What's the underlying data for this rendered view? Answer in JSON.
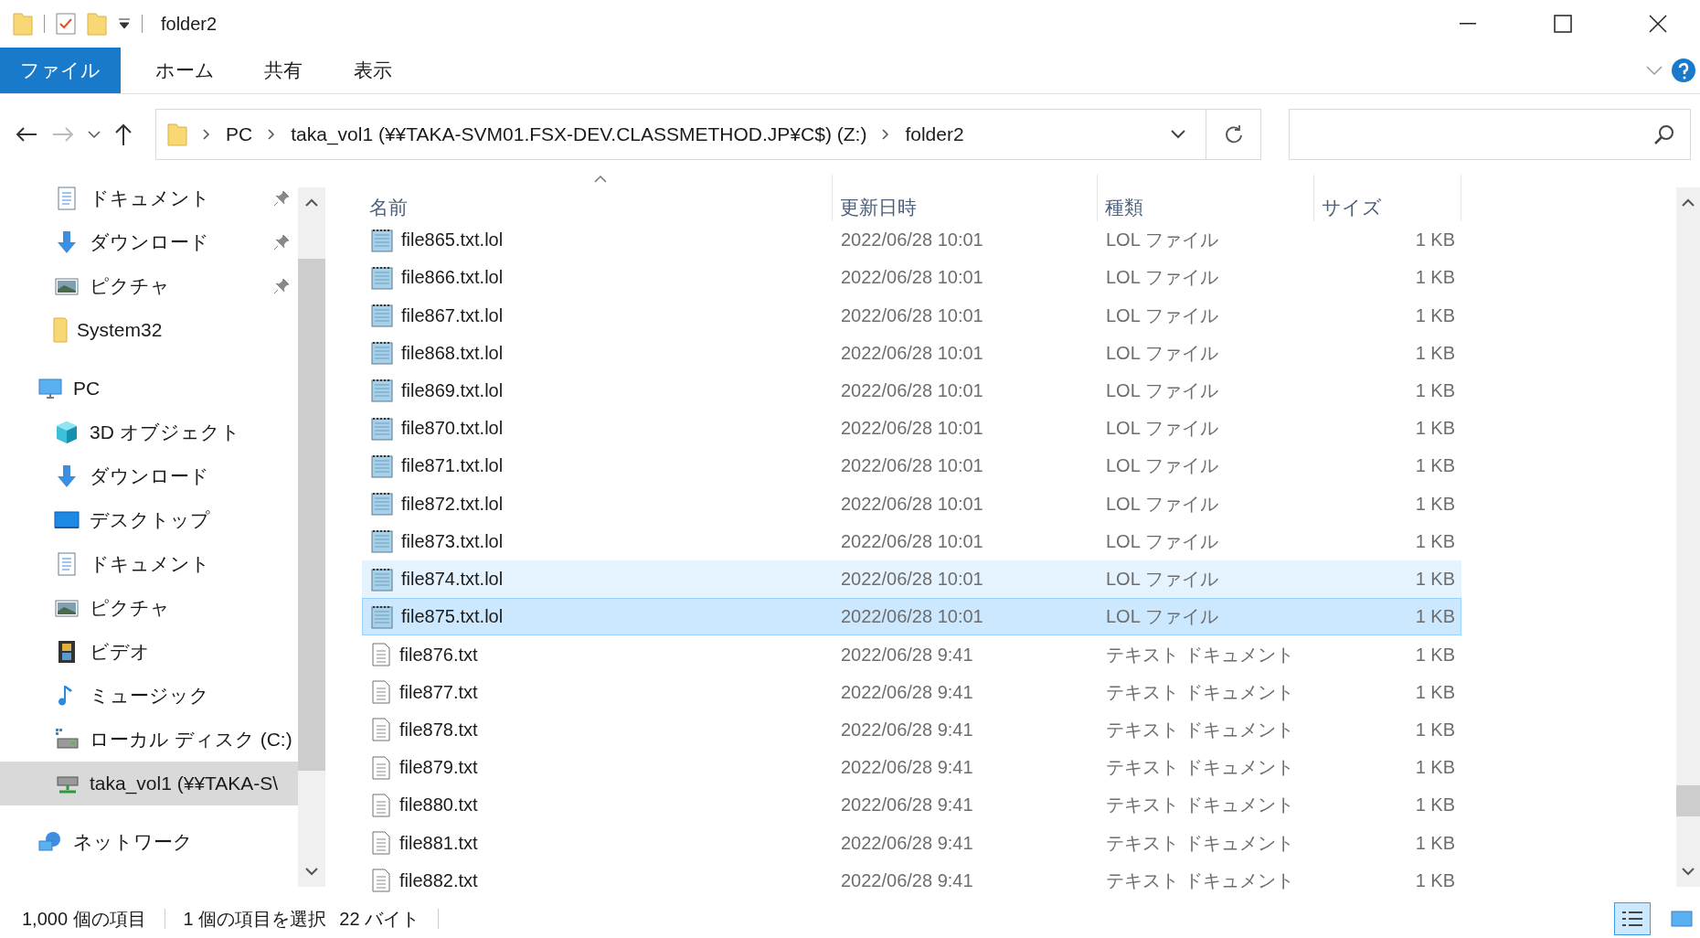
{
  "window": {
    "title": "folder2"
  },
  "ribbon": {
    "tabs": [
      {
        "label": "ファイル",
        "kind": "file"
      },
      {
        "label": "ホーム",
        "kind": "tab"
      },
      {
        "label": "共有",
        "kind": "tab"
      },
      {
        "label": "表示",
        "kind": "tab"
      }
    ]
  },
  "address_bar": {
    "path": [
      "PC",
      "taka_vol1 (¥¥TAKA-SVM01.FSX-DEV.CLASSMETHOD.JP¥C$) (Z:)",
      "folder2"
    ]
  },
  "sidebar": {
    "quick_access_items": [
      {
        "label": "ドキュメント",
        "kind": "document",
        "pinned": true,
        "selected": false
      },
      {
        "label": "ダウンロード",
        "kind": "download",
        "pinned": true,
        "selected": false
      },
      {
        "label": "ピクチャ",
        "kind": "picture",
        "pinned": true,
        "selected": false
      },
      {
        "label": "System32",
        "kind": "folder",
        "pinned": false,
        "selected": false
      }
    ],
    "items": [
      {
        "label": "PC",
        "kind": "pc",
        "selected": false,
        "children": [
          {
            "label": "3D オブジェクト",
            "kind": "cube",
            "selected": false
          },
          {
            "label": "ダウンロード",
            "kind": "download",
            "selected": false
          },
          {
            "label": "デスクトップ",
            "kind": "desktop",
            "selected": false
          },
          {
            "label": "ドキュメント",
            "kind": "document",
            "selected": false
          },
          {
            "label": "ピクチャ",
            "kind": "picture",
            "selected": false
          },
          {
            "label": "ビデオ",
            "kind": "video",
            "selected": false
          },
          {
            "label": "ミュージック",
            "kind": "music",
            "selected": false
          },
          {
            "label": "ローカル ディスク (C:)",
            "kind": "disk",
            "selected": false
          },
          {
            "label": "taka_vol1 (¥¥TAKA-S\\",
            "kind": "netdrive",
            "selected": true
          }
        ]
      },
      {
        "label": "ネットワーク",
        "kind": "network",
        "selected": false
      }
    ]
  },
  "table": {
    "columns": [
      {
        "label": "名前",
        "sorted": true
      },
      {
        "label": "更新日時",
        "sorted": false
      },
      {
        "label": "種類",
        "sorted": false
      },
      {
        "label": "サイズ",
        "sorted": false
      }
    ],
    "rows": [
      {
        "name": "file865.txt.lol",
        "date": "2022/06/28 10:01",
        "type": "LOL ファイル",
        "size": "1 KB",
        "kind": "lol",
        "selected": false,
        "hovered": false
      },
      {
        "name": "file866.txt.lol",
        "date": "2022/06/28 10:01",
        "type": "LOL ファイル",
        "size": "1 KB",
        "kind": "lol",
        "selected": false,
        "hovered": false
      },
      {
        "name": "file867.txt.lol",
        "date": "2022/06/28 10:01",
        "type": "LOL ファイル",
        "size": "1 KB",
        "kind": "lol",
        "selected": false,
        "hovered": false
      },
      {
        "name": "file868.txt.lol",
        "date": "2022/06/28 10:01",
        "type": "LOL ファイル",
        "size": "1 KB",
        "kind": "lol",
        "selected": false,
        "hovered": false
      },
      {
        "name": "file869.txt.lol",
        "date": "2022/06/28 10:01",
        "type": "LOL ファイル",
        "size": "1 KB",
        "kind": "lol",
        "selected": false,
        "hovered": false
      },
      {
        "name": "file870.txt.lol",
        "date": "2022/06/28 10:01",
        "type": "LOL ファイル",
        "size": "1 KB",
        "kind": "lol",
        "selected": false,
        "hovered": false
      },
      {
        "name": "file871.txt.lol",
        "date": "2022/06/28 10:01",
        "type": "LOL ファイル",
        "size": "1 KB",
        "kind": "lol",
        "selected": false,
        "hovered": false
      },
      {
        "name": "file872.txt.lol",
        "date": "2022/06/28 10:01",
        "type": "LOL ファイル",
        "size": "1 KB",
        "kind": "lol",
        "selected": false,
        "hovered": false
      },
      {
        "name": "file873.txt.lol",
        "date": "2022/06/28 10:01",
        "type": "LOL ファイル",
        "size": "1 KB",
        "kind": "lol",
        "selected": false,
        "hovered": false
      },
      {
        "name": "file874.txt.lol",
        "date": "2022/06/28 10:01",
        "type": "LOL ファイル",
        "size": "1 KB",
        "kind": "lol",
        "selected": false,
        "hovered": true
      },
      {
        "name": "file875.txt.lol",
        "date": "2022/06/28 10:01",
        "type": "LOL ファイル",
        "size": "1 KB",
        "kind": "lol",
        "selected": true,
        "hovered": false
      },
      {
        "name": "file876.txt",
        "date": "2022/06/28 9:41",
        "type": "テキスト ドキュメント",
        "size": "1 KB",
        "kind": "txt",
        "selected": false,
        "hovered": false
      },
      {
        "name": "file877.txt",
        "date": "2022/06/28 9:41",
        "type": "テキスト ドキュメント",
        "size": "1 KB",
        "kind": "txt",
        "selected": false,
        "hovered": false
      },
      {
        "name": "file878.txt",
        "date": "2022/06/28 9:41",
        "type": "テキスト ドキュメント",
        "size": "1 KB",
        "kind": "txt",
        "selected": false,
        "hovered": false
      },
      {
        "name": "file879.txt",
        "date": "2022/06/28 9:41",
        "type": "テキスト ドキュメント",
        "size": "1 KB",
        "kind": "txt",
        "selected": false,
        "hovered": false
      },
      {
        "name": "file880.txt",
        "date": "2022/06/28 9:41",
        "type": "テキスト ドキュメント",
        "size": "1 KB",
        "kind": "txt",
        "selected": false,
        "hovered": false
      },
      {
        "name": "file881.txt",
        "date": "2022/06/28 9:41",
        "type": "テキスト ドキュメント",
        "size": "1 KB",
        "kind": "txt",
        "selected": false,
        "hovered": false
      },
      {
        "name": "file882.txt",
        "date": "2022/06/28 9:41",
        "type": "テキスト ドキュメント",
        "size": "1 KB",
        "kind": "txt",
        "selected": false,
        "hovered": false
      }
    ]
  },
  "status_bar": {
    "item_count": "1,000 個の項目",
    "selection": "1 個の項目を選択",
    "selection_size": "22 バイト"
  }
}
